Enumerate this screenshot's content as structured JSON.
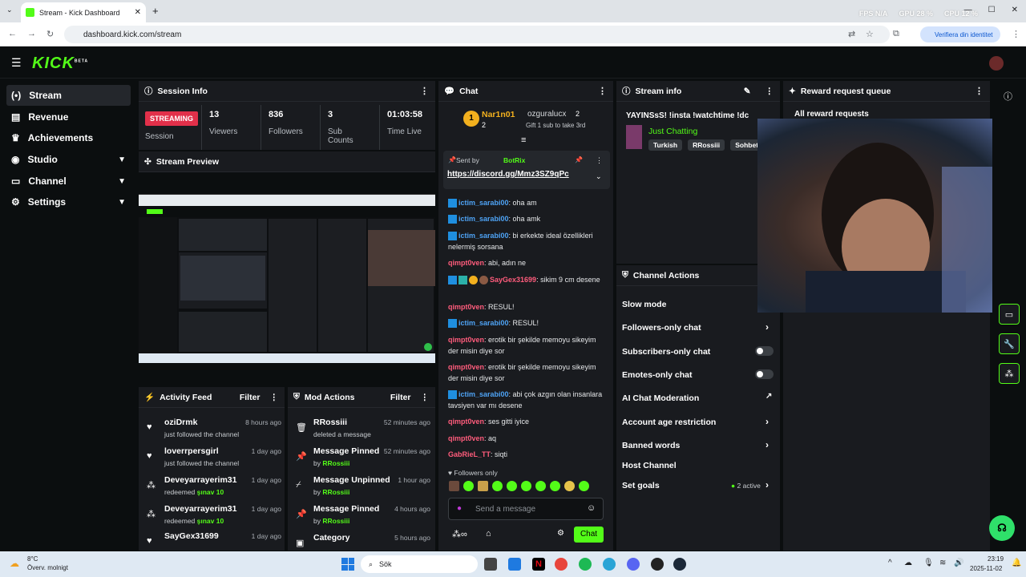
{
  "browser": {
    "tab_title": "Stream - Kick Dashboard",
    "url": "dashboard.kick.com/stream",
    "verify_label": "Verifiera din identitet",
    "perf": {
      "fps": "FPS N/A",
      "gpu": "GPU 28 %",
      "cpu": "CPU 12 %"
    }
  },
  "app": {
    "logo": "KICK",
    "logo_sup": "BETA"
  },
  "sidebar": {
    "items": [
      {
        "label": "Stream",
        "icon": "stream-icon"
      },
      {
        "label": "Revenue",
        "icon": "revenue-icon"
      },
      {
        "label": "Achievements",
        "icon": "trophy-icon"
      },
      {
        "label": "Studio",
        "icon": "studio-icon"
      },
      {
        "label": "Channel",
        "icon": "channel-icon"
      },
      {
        "label": "Settings",
        "icon": "gear-icon"
      }
    ]
  },
  "session": {
    "title": "Session Info",
    "status": "STREAMING",
    "status_label": "Session",
    "viewers": "13",
    "viewers_label": "Viewers",
    "followers": "836",
    "followers_label": "Followers",
    "subs": "3",
    "subs_label": "Sub Counts",
    "time": "01:03:58",
    "time_label": "Time Live"
  },
  "preview": {
    "title": "Stream Preview"
  },
  "activity": {
    "title": "Activity Feed",
    "filter": "Filter",
    "items": [
      {
        "name": "oziDrmk",
        "sub": "just followed the channel",
        "time": "8 hours ago",
        "extra": ""
      },
      {
        "name": "loverrpersgirl",
        "sub": "just followed the channel",
        "time": "1 day ago",
        "extra": ""
      },
      {
        "name": "Deveyarrayerim31",
        "sub": "redeemed ",
        "time": "1 day ago",
        "extra": "şınav 10"
      },
      {
        "name": "Deveyarrayerim31",
        "sub": "redeemed ",
        "time": "1 day ago",
        "extra": "şınav 10"
      },
      {
        "name": "SayGex31699",
        "sub": "",
        "time": "1 day ago",
        "extra": ""
      }
    ]
  },
  "mod": {
    "title": "Mod Actions",
    "filter": "Filter",
    "items": [
      {
        "name": "RRossiii",
        "sub": "deleted a message",
        "time": "52 minutes ago",
        "by": ""
      },
      {
        "name": "Message Pinned",
        "sub": "by ",
        "time": "52 minutes ago",
        "by": "RRossiii"
      },
      {
        "name": "Message Unpinned",
        "sub": "by ",
        "time": "1 hour ago",
        "by": "RRossiii"
      },
      {
        "name": "Message Pinned",
        "sub": "by ",
        "time": "4 hours ago",
        "by": "RRossiii"
      },
      {
        "name": "Category",
        "sub": "",
        "time": "5 hours ago",
        "by": ""
      }
    ]
  },
  "chat": {
    "title": "Chat",
    "leader1": "Nar1n01",
    "leader1_count": "2",
    "leader2": "ozguralucx",
    "leader2_count": "2",
    "gift_text": "Gift 1 sub to take 3rd",
    "pin_sent_by": "Sent by",
    "pin_user": "BotRix",
    "pin_link": "https://discord.gg/Mmz3SZ9qPc",
    "messages": [
      {
        "user": "ictim_sarabi00",
        "text": ": oha am",
        "color": "#4ea3f5"
      },
      {
        "user": "ictim_sarabi00",
        "text": ": oha amk",
        "color": "#4ea3f5"
      },
      {
        "user": "ictim_sarabi00",
        "text": ": bi erkekte ideal özellikleri nelermiş sorsana",
        "color": "#4ea3f5"
      },
      {
        "user": "qimpt0ven",
        "text": ": abi, adın ne",
        "color": "#ff5c7c"
      },
      {
        "user": "SayGex31699",
        "text": ": sikim 9 cm desene",
        "color": "#ff5c7c"
      },
      {
        "user": "qimpt0ven",
        "text": ": RESUL!",
        "color": "#ff5c7c"
      },
      {
        "user": "ictim_sarabi00",
        "text": ": RESUL!",
        "color": "#4ea3f5"
      },
      {
        "user": "qimpt0ven",
        "text": ": erotik bir şekilde memoyu sikeyim der misin diye sor",
        "color": "#ff5c7c"
      },
      {
        "user": "qimpt0ven",
        "text": ": erotik bir şekilde memoyu sikeyim der misin diye sor",
        "color": "#ff5c7c"
      },
      {
        "user": "ictim_sarabi00",
        "text": ": abi çok azgın olan insanlara tavsiyen var mı desene",
        "color": "#4ea3f5"
      },
      {
        "user": "qimpt0ven",
        "text": ": ses gitti iyice",
        "color": "#ff5c7c"
      },
      {
        "user": "qimpt0ven",
        "text": ": aq",
        "color": "#ff5c7c"
      },
      {
        "user": "GabRieL_TT",
        "text": ": siqti",
        "color": "#ff5c7c"
      }
    ],
    "followers_only": "Followers only",
    "placeholder": "Send a message",
    "send": "Chat"
  },
  "stream_info": {
    "title": "Stream info",
    "stream_title": "YAYINSsS! !insta !watchtime !dc",
    "category": "Just Chatting",
    "tags": [
      "Turkish",
      "RRossiii",
      "Sohbet"
    ]
  },
  "channel_actions": {
    "title": "Channel Actions",
    "items": [
      "Slow mode",
      "Followers-only chat",
      "Subscribers-only chat",
      "Emotes-only chat",
      "AI Chat Moderation",
      "Account age restriction",
      "Banned words",
      "Host Channel",
      "Set goals"
    ],
    "goals_status": "2 active"
  },
  "reward": {
    "title": "Reward request queue",
    "all": "All reward requests"
  },
  "taskbar": {
    "weather_temp": "8°C",
    "weather_desc": "Överv. molnigt",
    "search": "Sök",
    "time": "23:19",
    "date": "2025-11-02"
  }
}
